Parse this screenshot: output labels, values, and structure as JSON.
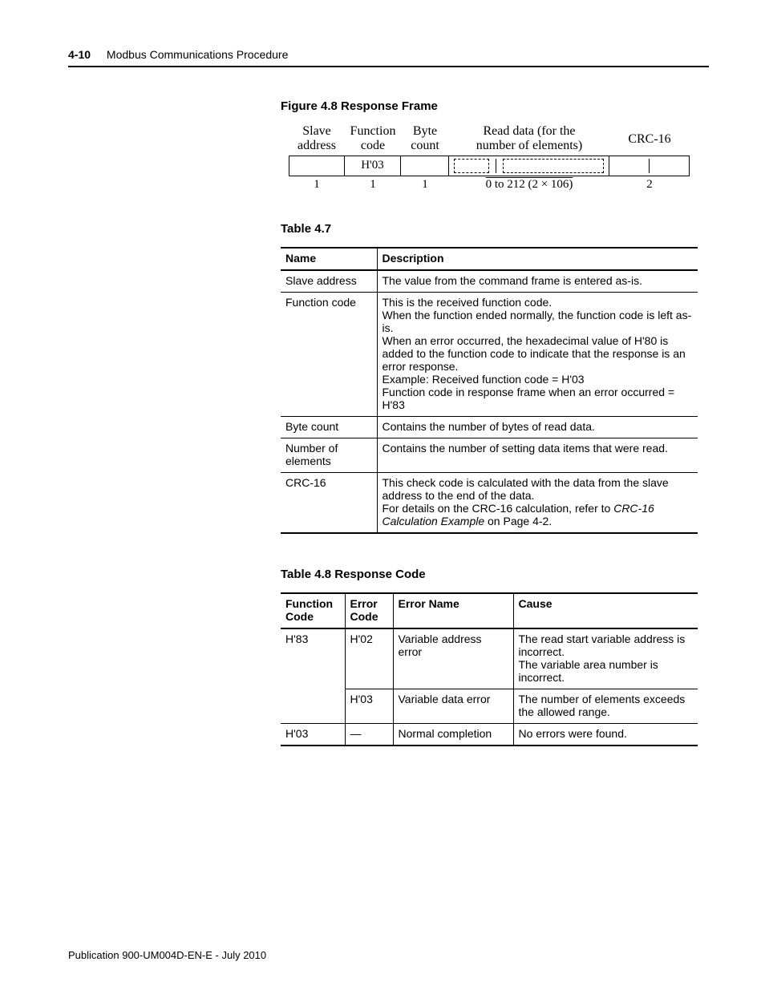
{
  "header": {
    "page_number": "4-10",
    "section_title": "Modbus Communications Procedure"
  },
  "figure": {
    "caption": "Figure 4.8 Response Frame",
    "columns": {
      "slave": {
        "label_top": "Slave",
        "label_bot": "address",
        "byte_count": "1"
      },
      "func": {
        "label_top": "Function",
        "label_bot": "code",
        "byte_count": "1",
        "value": "H'03"
      },
      "byte": {
        "label_top": "Byte",
        "label_bot": "count",
        "byte_count": "1"
      },
      "data": {
        "label_top": "Read data (for the",
        "label_bot": "number of elements)",
        "byte_count": "0 to 212 (2 × 106)"
      },
      "crc": {
        "label_top": "CRC-16",
        "label_bot": "",
        "byte_count": "2"
      }
    }
  },
  "table47": {
    "caption": "Table 4.7",
    "head": {
      "name": "Name",
      "desc": "Description"
    },
    "rows": [
      {
        "name": "Slave address",
        "desc": [
          "The value from the command frame is entered as-is."
        ]
      },
      {
        "name": "Function code",
        "desc": [
          "This is the received function code.",
          "When the function ended normally, the function code is left as-is.",
          "When an error occurred, the hexadecimal value of H'80 is added to the function code to indicate that the response is an error response.",
          "Example: Received function code = H'03",
          "Function code in response frame when an error occurred = H'83"
        ]
      },
      {
        "name": "Byte count",
        "desc": [
          "Contains the number of bytes of read data."
        ]
      },
      {
        "name": "Number of elements",
        "desc": [
          "Contains the number of setting data items that were read."
        ]
      },
      {
        "name": "CRC-16",
        "desc_rich": {
          "pre": "This check code is calculated with the data from the slave address to the end of the data.",
          "line2a": "For details on the CRC-16 calculation, refer to ",
          "ital": "CRC-16 Calculation Example",
          "line2b": " on Page 4-2."
        }
      }
    ]
  },
  "table48": {
    "caption": "Table 4.8 Response Code",
    "head": {
      "c1": "Function Code",
      "c2": "Error Code",
      "c3": "Error Name",
      "c4": "Cause"
    },
    "rows": [
      {
        "c1": "H'83",
        "c2": "H'02",
        "c3": "Variable address error",
        "c4": "The read start variable address is incorrect.\nThe variable area number is incorrect."
      },
      {
        "c1": "",
        "c2": "H'03",
        "c3": "Variable data error",
        "c4": "The number of elements exceeds the allowed range."
      },
      {
        "c1": "H'03",
        "c2": "—",
        "c3": "Normal completion",
        "c4": "No errors were found."
      }
    ]
  },
  "footer": {
    "text": "Publication 900-UM004D-EN-E - July 2010"
  }
}
